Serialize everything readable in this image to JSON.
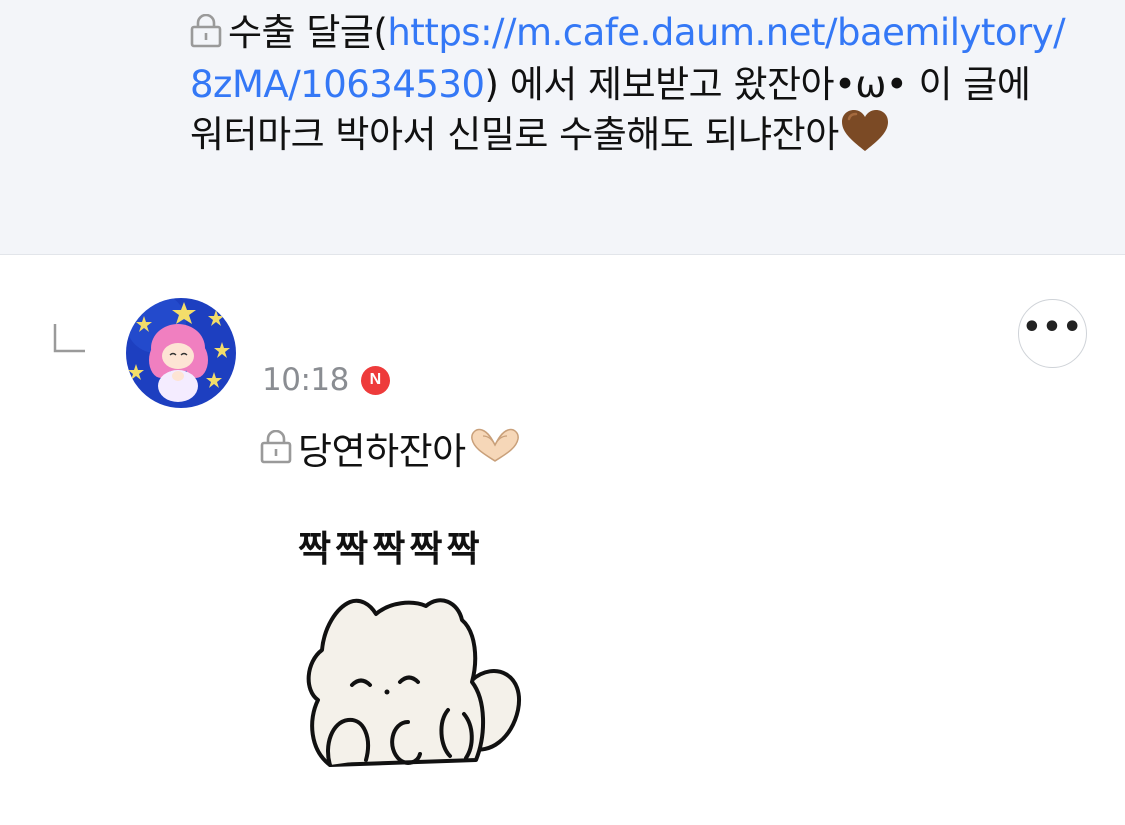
{
  "parent_comment": {
    "text_before_link": "수출 달글(",
    "link_text": "https://m.cafe.daum.net/baemilytory/8zMA/10634530",
    "text_after_link": ") 에서 제보받고 왔잔아•ω• 이 글에 워터마크 박아서 신밀로 수출해도 되냐잔아",
    "trailing_emoji": "brown-heart-icon"
  },
  "reply": {
    "time": "10:18",
    "badge": "N",
    "text": "당연하잔아",
    "text_emoji": "heart-hands-icon",
    "sticker_caption": "짝짝짝짝짝",
    "sticker": "clapping-white-cat-sticker"
  },
  "icons": {
    "lock": "lock-icon",
    "reply_arrow": "reply-arrow-icon",
    "more": "more-icon"
  },
  "colors": {
    "link": "#3478f6",
    "parent_bg": "#f3f5f9",
    "time": "#8a8d92",
    "badge": "#ee3b3b",
    "heart": "#7b4a25"
  }
}
